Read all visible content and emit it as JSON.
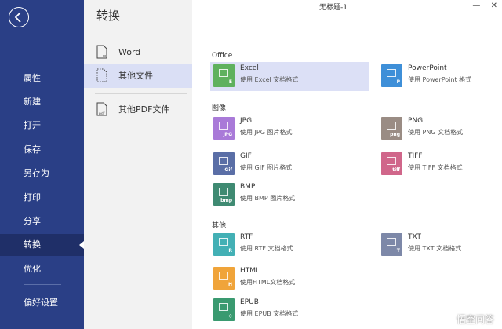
{
  "colors": {
    "nav_bg": "#2a3f86",
    "nav_active": "#1f2f68",
    "sub_bg": "#f2f2f2",
    "sub_active": "#dadff5",
    "selected_row": "#dce0f6"
  },
  "window": {
    "title": "无标题-1",
    "minimize": "—",
    "close": "✕"
  },
  "nav": {
    "items": [
      {
        "label": "属性"
      },
      {
        "label": "新建"
      },
      {
        "label": "打开"
      },
      {
        "label": "保存"
      },
      {
        "label": "另存为"
      },
      {
        "label": "打印"
      },
      {
        "label": "分享"
      },
      {
        "label": "转换",
        "active": true
      },
      {
        "label": "优化"
      },
      {
        "label": "偏好设置"
      }
    ]
  },
  "sub": {
    "title": "转换",
    "items": [
      {
        "label": "Word",
        "icon_letter": "w"
      },
      {
        "label": "其他文件",
        "active": true
      },
      {
        "label": "其他PDF文件",
        "icon_letter": "pdf"
      }
    ]
  },
  "sections": [
    {
      "label": "Office"
    },
    {
      "label": "图像"
    },
    {
      "label": "其他"
    }
  ],
  "formats": [
    {
      "name": "Excel",
      "desc": "使用 Excel 文档格式",
      "letter": "E",
      "color": "#5fb15e",
      "selected": true
    },
    {
      "name": "PowerPoint",
      "desc": "使用 PowerPoint 格式",
      "letter": "P",
      "color": "#3e8fd8"
    },
    {
      "name": "JPG",
      "desc": "使用 JPG 图片格式",
      "letter": "JPG",
      "color": "#a97ad8"
    },
    {
      "name": "PNG",
      "desc": "使用 PNG 文档格式",
      "letter": "png",
      "color": "#9a8c84"
    },
    {
      "name": "GIF",
      "desc": "使用 GIF 图片格式",
      "letter": "Gif",
      "color": "#5a6ea6"
    },
    {
      "name": "TIFF",
      "desc": "使用 TIFF 文档格式",
      "letter": "tiff",
      "color": "#d0668a"
    },
    {
      "name": "BMP",
      "desc": "使用 BMP 图片格式",
      "letter": "bmp",
      "color": "#3f8a72"
    },
    {
      "name": "RTF",
      "desc": "使用 RTF 文档格式",
      "letter": "R",
      "color": "#43b0b5"
    },
    {
      "name": "TXT",
      "desc": "使用 TXT 文档格式",
      "letter": "T",
      "color": "#7d88a8"
    },
    {
      "name": "HTML",
      "desc": "使用HTML文档格式",
      "letter": "H",
      "color": "#f0a43a"
    },
    {
      "name": "EPUB",
      "desc": "使用 EPUB 文档格式",
      "letter": "◇",
      "color": "#3a9a70"
    }
  ],
  "watermark": "悟空问答"
}
